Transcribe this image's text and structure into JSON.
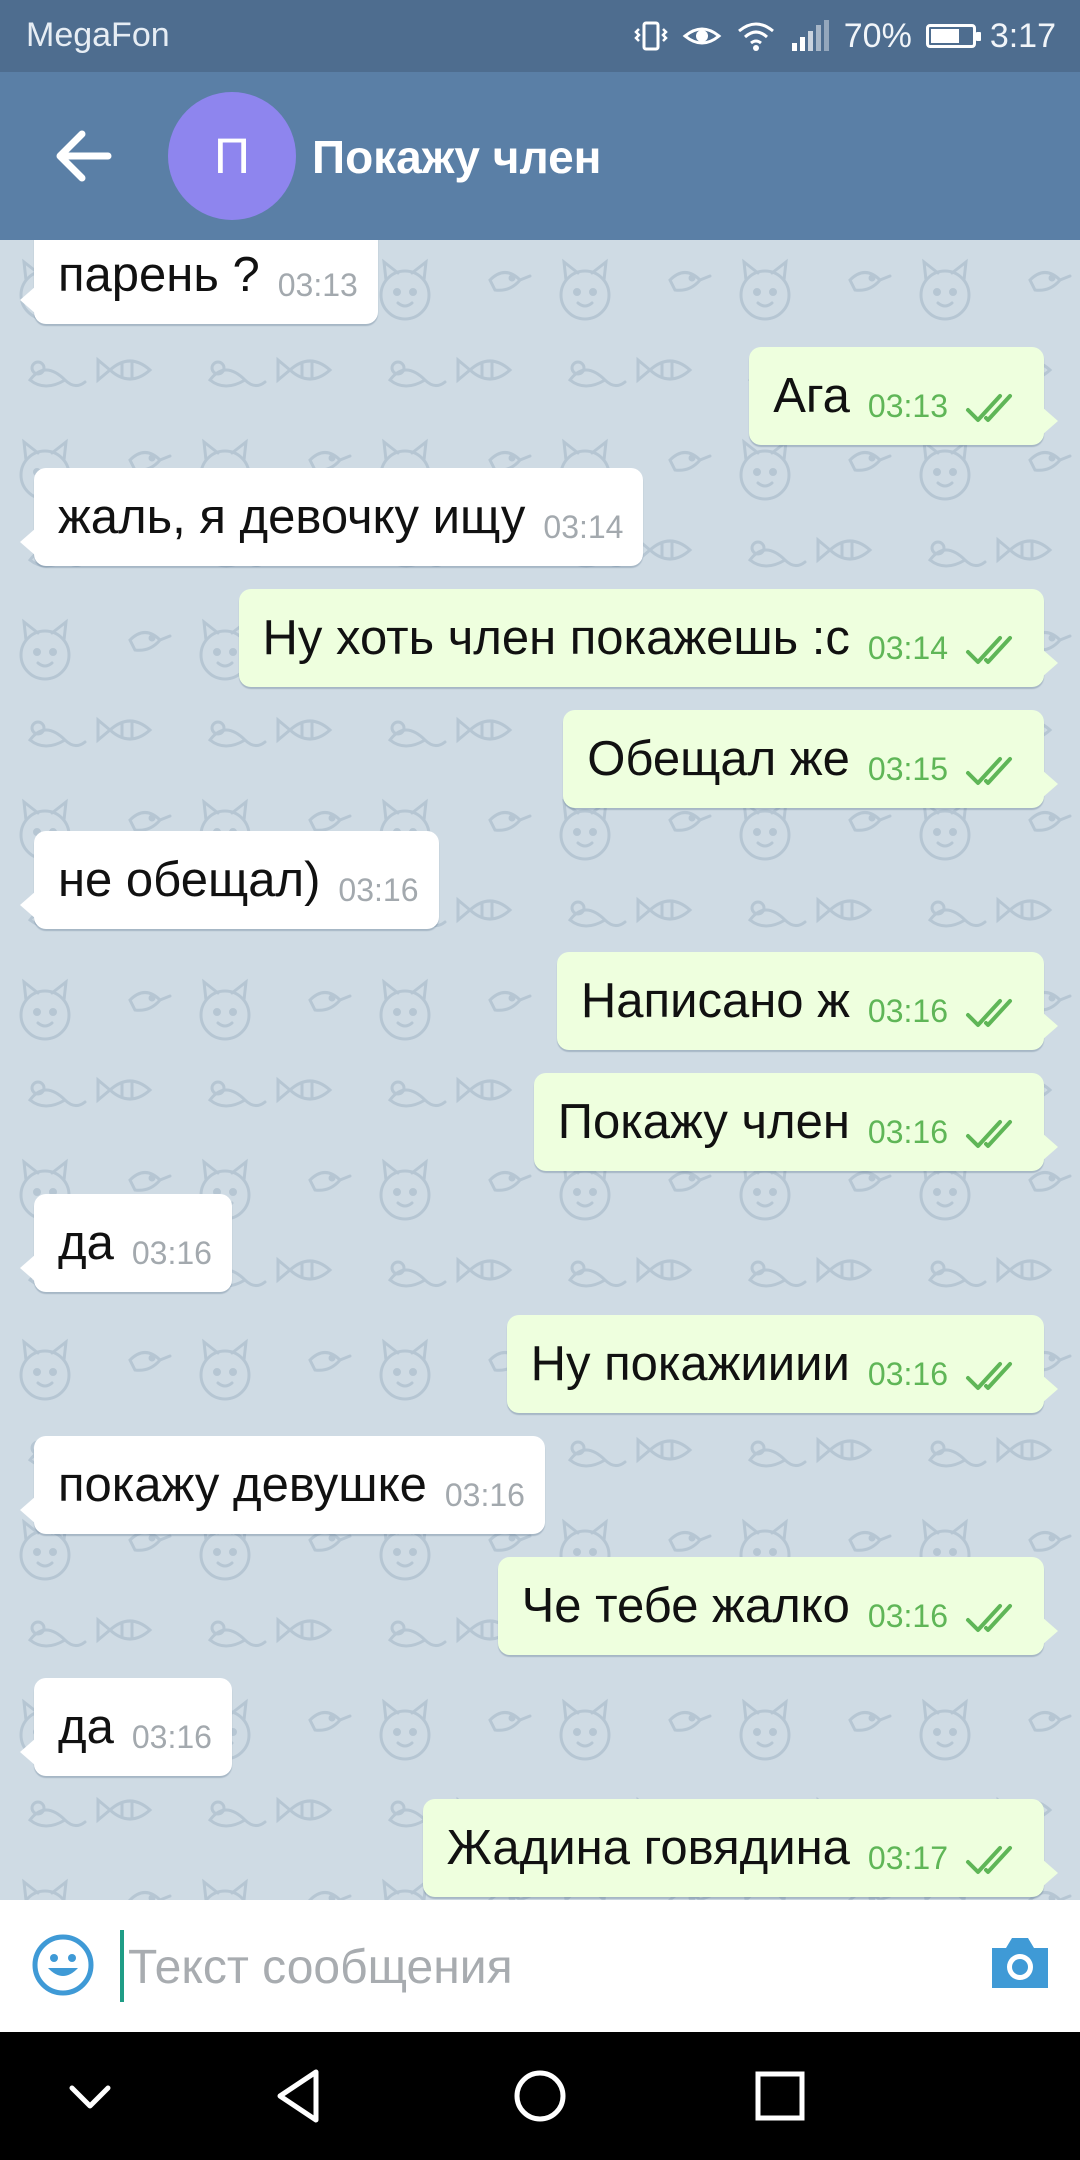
{
  "status_bar": {
    "carrier": "MegaFon",
    "battery_text": "70%",
    "battery_level": 0.7,
    "time": "3:17"
  },
  "header": {
    "avatar_letter": "П",
    "avatar_color": "#8e85ee",
    "title": "Покажу член"
  },
  "messages": [
    {
      "dir": "in",
      "text": "парень ?",
      "time": "03:13"
    },
    {
      "dir": "out",
      "text": "Ага",
      "time": "03:13",
      "read": true
    },
    {
      "dir": "in",
      "text": "жаль, я девочку ищу",
      "time": "03:14"
    },
    {
      "dir": "out",
      "text": "Ну хоть член покажешь :с",
      "time": "03:14",
      "read": true
    },
    {
      "dir": "out",
      "text": "Обещал же",
      "time": "03:15",
      "read": true
    },
    {
      "dir": "in",
      "text": "не обещал)",
      "time": "03:16"
    },
    {
      "dir": "out",
      "text": "Написано ж",
      "time": "03:16",
      "read": true
    },
    {
      "dir": "out",
      "text": "Покажу член",
      "time": "03:16",
      "read": true
    },
    {
      "dir": "in",
      "text": "да",
      "time": "03:16"
    },
    {
      "dir": "out",
      "text": "Ну покажииии",
      "time": "03:16",
      "read": true
    },
    {
      "dir": "in",
      "text": "покажу девушке",
      "time": "03:16"
    },
    {
      "dir": "out",
      "text": "Че тебе жалко",
      "time": "03:16",
      "read": true
    },
    {
      "dir": "in",
      "text": "да",
      "time": "03:16"
    },
    {
      "dir": "out",
      "text": "Жадина говядина",
      "time": "03:17",
      "read": true
    }
  ],
  "input": {
    "placeholder": "Текст сообщения",
    "value": ""
  },
  "icons": {
    "back": "arrow-left-icon",
    "emoji": "smiley-icon",
    "camera": "camera-icon",
    "nav_down": "chevron-down-icon",
    "nav_back": "triangle-back-icon",
    "nav_home": "circle-home-icon",
    "nav_recent": "square-recent-icon"
  },
  "colors": {
    "header": "#5a7fa6",
    "status_bar": "#4e6d8f",
    "chat_bg": "#cfdbe4",
    "incoming_bubble": "#ffffff",
    "outgoing_bubble": "#eeffde",
    "outgoing_time": "#5fb657",
    "accent": "#3f9ad6"
  }
}
